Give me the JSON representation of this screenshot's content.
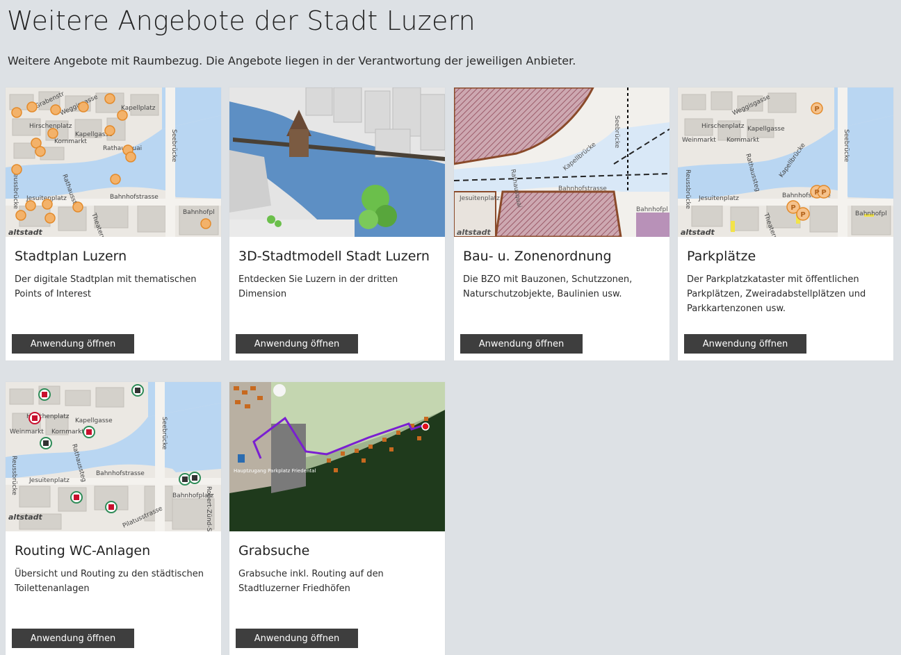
{
  "page": {
    "title": "Weitere Angebote der Stadt Luzern",
    "intro": "Weitere Angebote mit Raumbezug. Die Angebote liegen in der Verantwortung der jeweiligen Anbieter."
  },
  "button_label": "Anwendung öffnen",
  "cards": [
    {
      "title": "Stadtplan Luzern",
      "description": "Der digitale Stadtplan mit thematischen Points of Interest",
      "map_labels": {
        "a": "Hirschenplatz",
        "b": "Kapellgasse",
        "c": "Kornmarkt",
        "d": "Rathausquai",
        "e": "Bahnhofstrasse",
        "f": "Jesuitenplatz",
        "g": "Seebrücke",
        "h": "Reussbrücke",
        "i": "Bahnhofpl",
        "j": "Theaterstr",
        "k": "Rathaussteg",
        "l": "Kapellplatz",
        "m": "Weggisgasse",
        "n": "Grabenstr",
        "o": "altstadt"
      }
    },
    {
      "title": "3D-Stadtmodell Stadt Luzern",
      "description": "Entdecken Sie Luzern in der dritten Dimension"
    },
    {
      "title": "Bau- u. Zonenordnung",
      "description": "Die BZO mit Bauzonen, Schutzzonen, Naturschutzobjekte, Baulinien usw.",
      "map_labels": {
        "a": "Bahnhofstrasse",
        "b": "Jesuitenplatz",
        "c": "Seebrücke",
        "d": "Kapellbrücke",
        "e": "Bahnhofpl",
        "f": "altstadt",
        "g": "Rathausquai"
      }
    },
    {
      "title": "Parkplätze",
      "description": "Der Parkplatzkataster mit öffentlichen Parkplätzen, Zweiradabstellplätzen und Parkkartenzonen usw.",
      "map_labels": {
        "a": "Hirschenplatz",
        "b": "Kapellgasse",
        "c": "Kornmarkt",
        "d": "Weinmarkt",
        "e": "Bahnhofstrasse",
        "f": "Jesuitenplatz",
        "g": "Seebrücke",
        "h": "Reussbrücke",
        "i": "Bahnhofpl",
        "j": "Theaterstr",
        "k": "Rathaussteg",
        "l": "Kapellbrücke",
        "m": "Weggisgasse",
        "n": "altstadt",
        "o": "P"
      }
    },
    {
      "title": "Routing WC-Anlagen",
      "description": "Übersicht und Routing zu den städtischen Toilettenanlagen",
      "map_labels": {
        "a": "Hirschenplatz",
        "b": "Kapellgasse",
        "c": "Kornmarkt",
        "d": "Weinmarkt",
        "e": "Bahnhofstrasse",
        "f": "Jesuitenplatz",
        "g": "Seebrücke",
        "h": "Reussbrücke",
        "i": "Bahnhofplatz",
        "j": "Rathaussteg",
        "k": "Pilatusstrasse",
        "l": "Robert-Zünd-Str",
        "m": "altstadt"
      }
    },
    {
      "title": "Grabsuche",
      "description": "Grabsuche inkl. Routing auf den Stadtluzerner Friedhöfen",
      "map_labels": {
        "a": "Hauptzugang Parkplatz Friedental"
      }
    }
  ]
}
